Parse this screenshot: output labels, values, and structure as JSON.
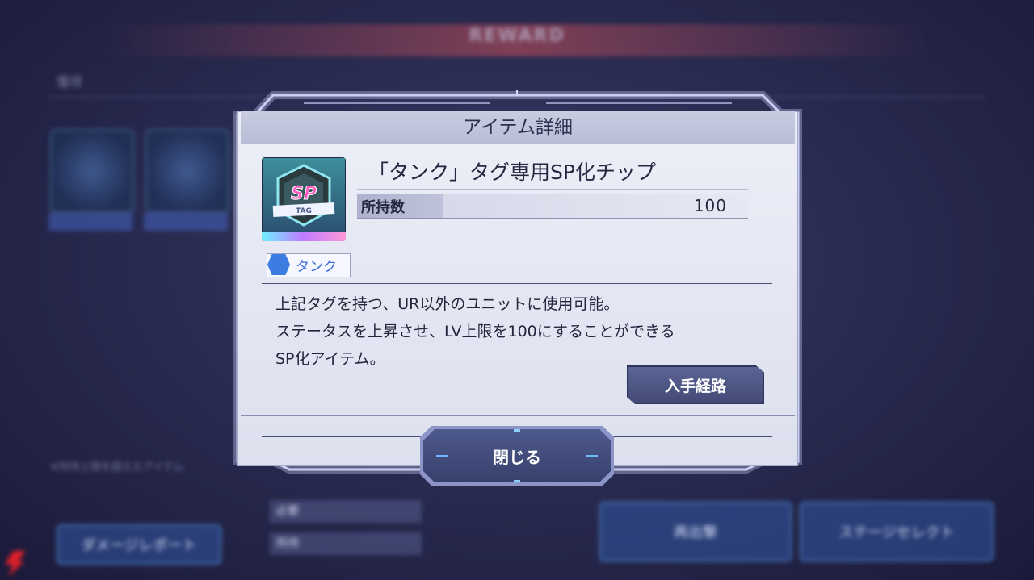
{
  "dialog": {
    "title": "アイテム詳細",
    "item_name": "「タンク」タグ専用SP化チップ",
    "owned_label": "所持数",
    "owned_value": "100",
    "tag_label": "タンク",
    "description": [
      "上記タグを持つ、UR以外のユニットに使用可能。",
      "ステータスを上昇させ、LV上限を100にすることができる",
      "SP化アイテム。"
    ],
    "route_button": "入手経路",
    "close_button": "閉じる"
  },
  "icon": {
    "sp_text": "SP",
    "tag_text": "TAG"
  },
  "colors": {
    "accent_blue": "#3d7ce0",
    "header_text": "#2e3150",
    "panel": "#e4e6f2",
    "button_dark": "#434a77"
  }
}
